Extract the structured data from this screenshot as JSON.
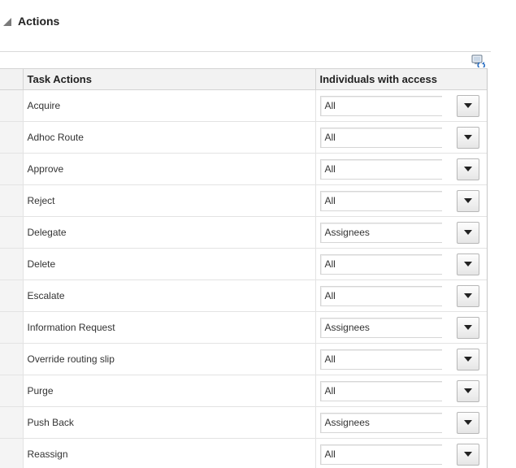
{
  "section": {
    "title": "Actions"
  },
  "table": {
    "columns": [
      "Task Actions",
      "Individuals with access"
    ],
    "rows": [
      {
        "action": "Acquire",
        "access": "All"
      },
      {
        "action": "Adhoc Route",
        "access": "All"
      },
      {
        "action": "Approve",
        "access": "All"
      },
      {
        "action": "Reject",
        "access": "All"
      },
      {
        "action": "Delegate",
        "access": "Assignees"
      },
      {
        "action": "Delete",
        "access": "All"
      },
      {
        "action": "Escalate",
        "access": "All"
      },
      {
        "action": "Information Request",
        "access": "Assignees"
      },
      {
        "action": "Override routing slip",
        "access": "All"
      },
      {
        "action": "Purge",
        "access": "All"
      },
      {
        "action": "Push Back",
        "access": "Assignees"
      },
      {
        "action": "Reassign",
        "access": "All"
      }
    ]
  },
  "icons": {
    "collapse": "triangle-down-icon",
    "refresh": "refresh-icon",
    "dropdown": "chevron-down-icon"
  }
}
